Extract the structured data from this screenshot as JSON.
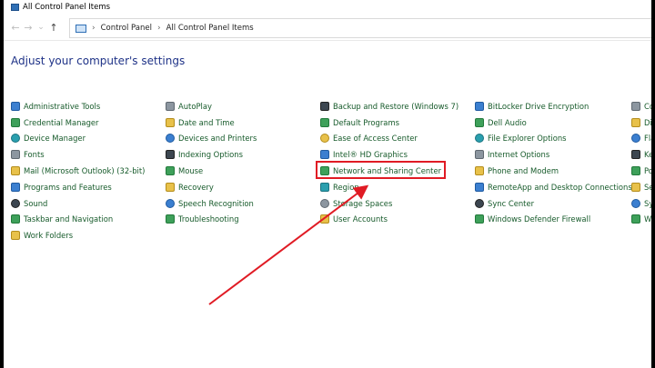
{
  "window": {
    "title": "All Control Panel Items"
  },
  "address": {
    "crumbs": [
      "Control Panel",
      "All Control Panel Items"
    ],
    "separator": "›"
  },
  "heading": "Adjust your computer's settings",
  "columns": [
    [
      {
        "label": "Administrative Tools",
        "icon": "administrative-tools-icon"
      },
      {
        "label": "Credential Manager",
        "icon": "credential-manager-icon"
      },
      {
        "label": "Device Manager",
        "icon": "device-manager-icon"
      },
      {
        "label": "Fonts",
        "icon": "fonts-icon"
      },
      {
        "label": "Mail (Microsoft Outlook) (32-bit)",
        "icon": "mail-icon"
      },
      {
        "label": "Programs and Features",
        "icon": "programs-features-icon"
      },
      {
        "label": "Sound",
        "icon": "sound-icon"
      },
      {
        "label": "Taskbar and Navigation",
        "icon": "taskbar-icon"
      },
      {
        "label": "Work Folders",
        "icon": "work-folders-icon"
      }
    ],
    [
      {
        "label": "AutoPlay",
        "icon": "autoplay-icon"
      },
      {
        "label": "Date and Time",
        "icon": "date-time-icon"
      },
      {
        "label": "Devices and Printers",
        "icon": "devices-printers-icon"
      },
      {
        "label": "Indexing Options",
        "icon": "indexing-icon"
      },
      {
        "label": "Mouse",
        "icon": "mouse-icon"
      },
      {
        "label": "Recovery",
        "icon": "recovery-icon"
      },
      {
        "label": "Speech Recognition",
        "icon": "speech-icon"
      },
      {
        "label": "Troubleshooting",
        "icon": "troubleshooting-icon"
      }
    ],
    [
      {
        "label": "Backup and Restore (Windows 7)",
        "icon": "backup-icon"
      },
      {
        "label": "Default Programs",
        "icon": "default-programs-icon"
      },
      {
        "label": "Ease of Access Center",
        "icon": "ease-access-icon"
      },
      {
        "label": "Intel® HD Graphics",
        "icon": "intel-graphics-icon"
      },
      {
        "label": "Network and Sharing Center",
        "icon": "network-icon"
      },
      {
        "label": "Region",
        "icon": "region-icon"
      },
      {
        "label": "Storage Spaces",
        "icon": "storage-icon"
      },
      {
        "label": "User Accounts",
        "icon": "user-accounts-icon"
      }
    ],
    [
      {
        "label": "BitLocker Drive Encryption",
        "icon": "bitlocker-icon"
      },
      {
        "label": "Dell Audio",
        "icon": "dell-audio-icon"
      },
      {
        "label": "File Explorer Options",
        "icon": "file-explorer-icon"
      },
      {
        "label": "Internet Options",
        "icon": "internet-options-icon"
      },
      {
        "label": "Phone and Modem",
        "icon": "phone-modem-icon"
      },
      {
        "label": "RemoteApp and Desktop Connections",
        "icon": "remoteapp-icon"
      },
      {
        "label": "Sync Center",
        "icon": "sync-icon"
      },
      {
        "label": "Windows Defender Firewall",
        "icon": "firewall-icon"
      }
    ],
    [
      {
        "label": "Co",
        "icon": "color-management-icon"
      },
      {
        "label": "Dis",
        "icon": "display-icon"
      },
      {
        "label": "Fla",
        "icon": "flash-icon"
      },
      {
        "label": "Ke",
        "icon": "keyboard-icon"
      },
      {
        "label": "Po",
        "icon": "power-icon"
      },
      {
        "label": "Se",
        "icon": "security-icon"
      },
      {
        "label": "Sy",
        "icon": "system-icon"
      },
      {
        "label": "Wi",
        "icon": "windows-icon"
      }
    ]
  ],
  "annotation": {
    "highlight_color": "#e01b24"
  }
}
